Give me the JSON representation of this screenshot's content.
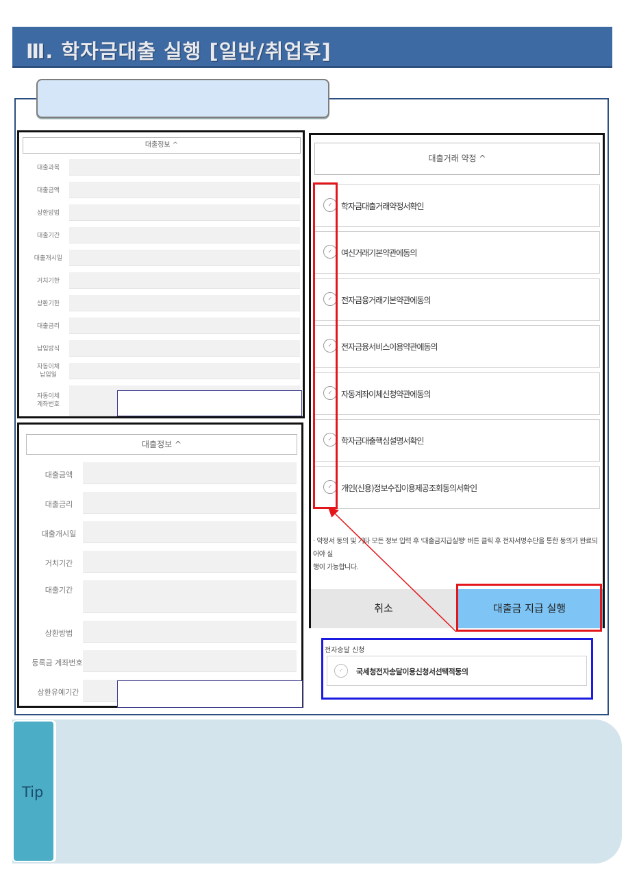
{
  "banner": {
    "title": "Ⅲ. 학자금대출 실행 [일반/취업후]"
  },
  "left_top": {
    "header": "대출정보 ^",
    "labels": [
      "대출과목",
      "대출금액",
      "상환방법",
      "대출기간",
      "대출개시일",
      "거치기한",
      "상환기한",
      "대출금리",
      "납입방식",
      "자동이체\n납입일",
      "자동이체\n계좌번호"
    ]
  },
  "left_bottom": {
    "header": "대출정보 ^",
    "labels": [
      "대출금액",
      "대출금리",
      "대출개시일",
      "거치기간",
      "대출기간",
      "상환방법",
      "등록금 계좌번호",
      "상환유예기간"
    ]
  },
  "right": {
    "header": "대출거래 약정 ^",
    "terms": [
      "학자금대출거래약정서확인",
      "여신거래기본약관에동의",
      "전자금융거래기본약관에동의",
      "전자금융서비스이용약관에동의",
      "자동계좌이체신청약관에동의",
      "학자금대출핵심설명서확인",
      "개인(신용)정보수집이용제공조회동의서확인"
    ],
    "check_glyph": "✓",
    "notice_line1": "· 약정서 동의 및 기타 모든 정보 입력 후 '대출금지급실행' 버튼 클릭 후 전자서명수단을 통한 동의가 완료되어야 실",
    "notice_line2": "행이 가능합니다.",
    "cancel_label": "취소",
    "execute_label": "대출금 지급 실행"
  },
  "edelivery": {
    "title": "전자송달 신청",
    "label": "국세청전자송달이용신청서선택적동의",
    "check_glyph": "✓"
  },
  "tip": {
    "label": "Tip"
  },
  "colors": {
    "banner": "#3e6aa3",
    "highlight_red": "#e3161c",
    "highlight_blue": "#1a1ae0",
    "execute_btn": "#7ec4f5",
    "tip_tab": "#4badc6"
  }
}
